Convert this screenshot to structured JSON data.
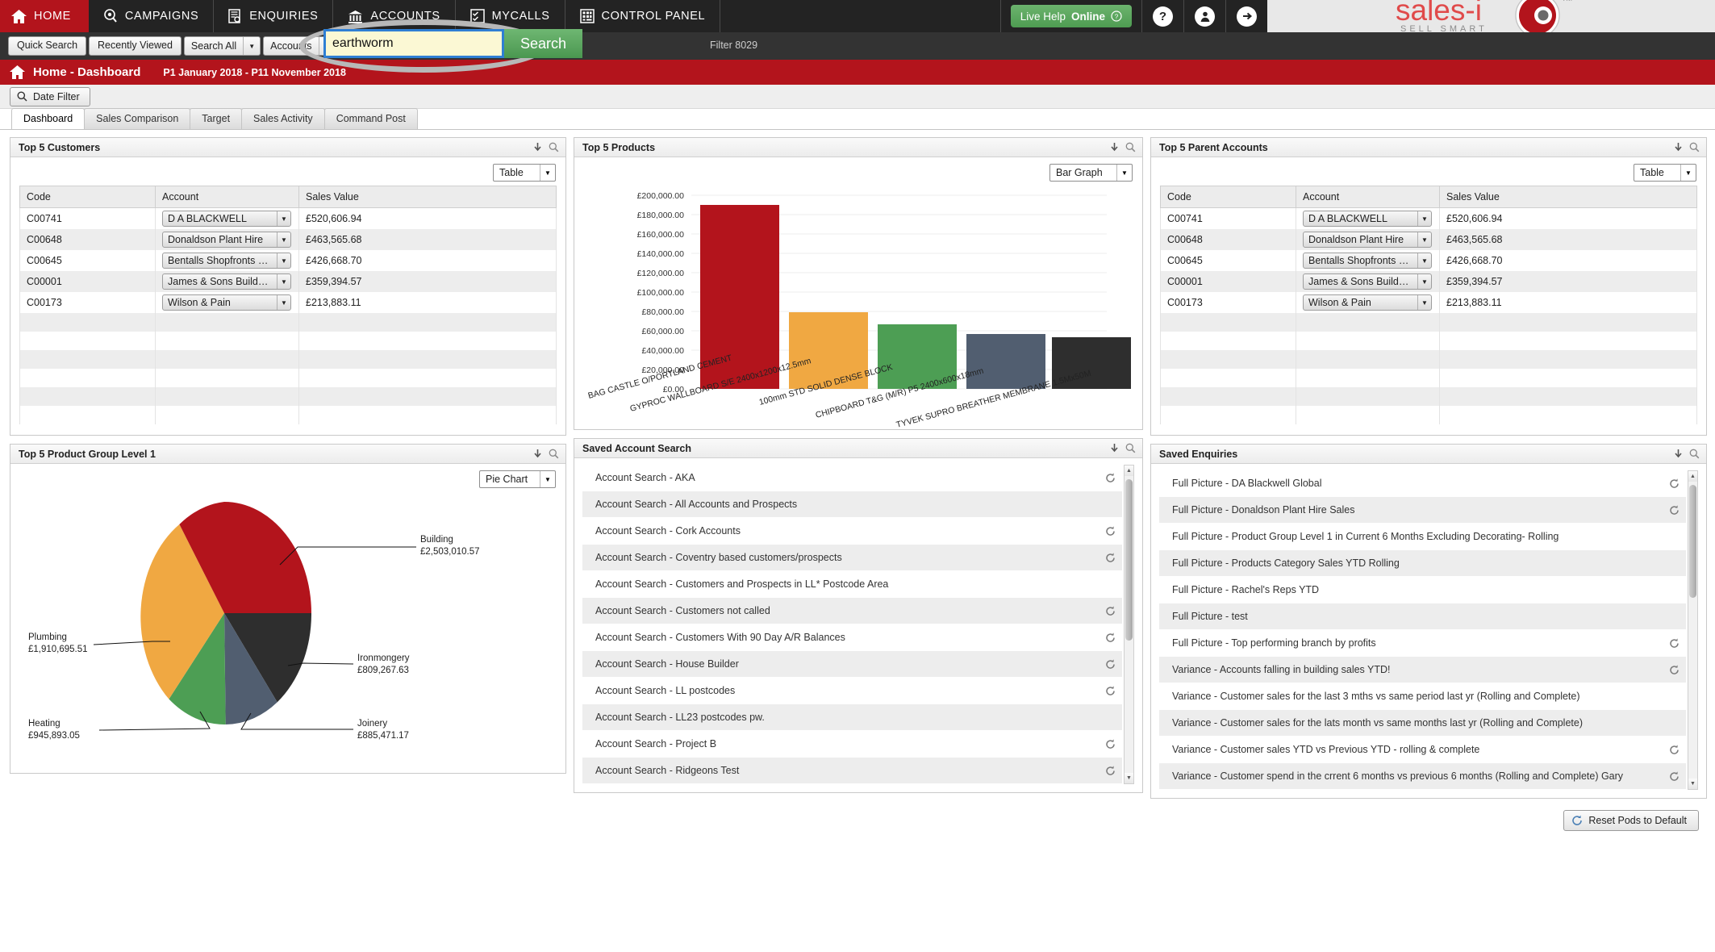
{
  "nav": {
    "items": [
      {
        "label": "HOME",
        "icon": "home-icon",
        "active": true
      },
      {
        "label": "CAMPAIGNS",
        "icon": "megaphone-icon",
        "active": false
      },
      {
        "label": "ENQUIRIES",
        "icon": "document-search-icon",
        "active": false
      },
      {
        "label": "ACCOUNTS",
        "icon": "bank-icon",
        "active": false
      },
      {
        "label": "MYCALLS",
        "icon": "checklist-icon",
        "active": false
      },
      {
        "label": "CONTROL PANEL",
        "icon": "grid-settings-icon",
        "active": false
      }
    ],
    "live_help": {
      "prefix": "Live Help ",
      "status": "Online",
      "icon": "question-circle-icon"
    },
    "icons": [
      {
        "name": "help-icon",
        "glyph": "?"
      },
      {
        "name": "user-profile-icon",
        "glyph": "❶"
      },
      {
        "name": "logout-icon",
        "glyph": "→"
      }
    ],
    "brand": {
      "name": "sales-i",
      "tagline": "SELL SMART",
      "trademark": "TM"
    }
  },
  "searchbar": {
    "quick_search": "Quick Search",
    "recently_viewed": "Recently Viewed",
    "search_scope": "Search All",
    "search_type": "Accounts",
    "query_value": "earthworm",
    "query_placeholder": "",
    "search_button": "Search",
    "filter_text": "Filter 8029"
  },
  "titlebar": {
    "icon": "home-icon",
    "title": "Home - Dashboard",
    "period": "P1 January 2018 - P11 November 2018"
  },
  "datefilter": {
    "label": "Date Filter",
    "icon": "magnifier-icon"
  },
  "tabs": [
    {
      "label": "Dashboard",
      "active": true
    },
    {
      "label": "Sales Comparison",
      "active": false
    },
    {
      "label": "Target",
      "active": false
    },
    {
      "label": "Sales Activity",
      "active": false
    },
    {
      "label": "Command Post",
      "active": false
    }
  ],
  "pods": {
    "top_customers": {
      "title": "Top 5 Customers",
      "view": "Table",
      "headers": [
        "Code",
        "Account",
        "Sales Value"
      ],
      "rows": [
        {
          "code": "C00741",
          "account": "D A BLACKWELL",
          "value": "£520,606.94"
        },
        {
          "code": "C00648",
          "account": "Donaldson Plant Hire",
          "value": "£463,565.68"
        },
        {
          "code": "C00645",
          "account": "Bentalls Shopfronts LTD",
          "value": "£426,668.70"
        },
        {
          "code": "C00001",
          "account": "James & Sons Builders...",
          "value": "£359,394.57"
        },
        {
          "code": "C00173",
          "account": "Wilson & Pain",
          "value": "£213,883.11"
        }
      ]
    },
    "top_parent_accounts": {
      "title": "Top 5 Parent Accounts",
      "view": "Table",
      "headers": [
        "Code",
        "Account",
        "Sales Value"
      ],
      "rows": [
        {
          "code": "C00741",
          "account": "D A BLACKWELL",
          "value": "£520,606.94"
        },
        {
          "code": "C00648",
          "account": "Donaldson Plant Hire",
          "value": "£463,565.68"
        },
        {
          "code": "C00645",
          "account": "Bentalls Shopfronts LTD",
          "value": "£426,668.70"
        },
        {
          "code": "C00001",
          "account": "James & Sons Builders...",
          "value": "£359,394.57"
        },
        {
          "code": "C00173",
          "account": "Wilson & Pain",
          "value": "£213,883.11"
        }
      ]
    },
    "top_products": {
      "title": "Top 5 Products",
      "view": "Bar Graph"
    },
    "product_group": {
      "title": "Top 5 Product Group Level 1",
      "view": "Pie Chart"
    },
    "saved_account_search": {
      "title": "Saved Account Search",
      "items": [
        {
          "label": "Account Search - AKA",
          "refresh": true
        },
        {
          "label": "Account Search - All Accounts and Prospects",
          "refresh": false
        },
        {
          "label": "Account Search - Cork Accounts",
          "refresh": true
        },
        {
          "label": "Account Search - Coventry based customers/prospects",
          "refresh": true
        },
        {
          "label": "Account Search - Customers and Prospects in LL* Postcode Area",
          "refresh": false
        },
        {
          "label": "Account Search - Customers not called",
          "refresh": true
        },
        {
          "label": "Account Search - Customers With 90 Day A/R Balances",
          "refresh": true
        },
        {
          "label": "Account Search - House Builder",
          "refresh": true
        },
        {
          "label": "Account Search - LL postcodes",
          "refresh": true
        },
        {
          "label": "Account Search - LL23 postcodes pw.",
          "refresh": false
        },
        {
          "label": "Account Search - Project B",
          "refresh": true
        },
        {
          "label": "Account Search - Ridgeons Test",
          "refresh": true
        }
      ]
    },
    "saved_enquiries": {
      "title": "Saved Enquiries",
      "items": [
        {
          "label": "Full Picture - DA Blackwell Global",
          "refresh": true
        },
        {
          "label": "Full Picture - Donaldson Plant Hire Sales",
          "refresh": true
        },
        {
          "label": "Full Picture - Product Group Level 1 in Current 6 Months  Excluding Decorating- Rolling",
          "refresh": false
        },
        {
          "label": "Full Picture - Products Category Sales YTD Rolling",
          "refresh": false
        },
        {
          "label": "Full Picture - Rachel's Reps YTD",
          "refresh": false
        },
        {
          "label": "Full Picture - test",
          "refresh": false
        },
        {
          "label": "Full Picture - Top performing branch by profits",
          "refresh": true
        },
        {
          "label": "Variance - Accounts falling in building sales YTD!",
          "refresh": true
        },
        {
          "label": "Variance - Customer sales for the last 3 mths vs same period last yr (Rolling and Complete)",
          "refresh": false
        },
        {
          "label": "Variance - Customer sales for the lats month vs same months last yr (Rolling and Complete)",
          "refresh": false
        },
        {
          "label": "Variance - Customer sales YTD vs Previous YTD - rolling & complete",
          "refresh": true
        },
        {
          "label": "Variance - Customer spend in the crrent 6 months vs previous 6 months (Rolling and Complete) Gary",
          "refresh": true
        }
      ]
    }
  },
  "footer": {
    "reset_label": "Reset Pods to Default",
    "reset_icon": "refresh-icon"
  },
  "chart_data": [
    {
      "type": "bar",
      "title": "Top 5 Products",
      "categories": [
        "BAG CASTLE O/PORTLAND CEMENT",
        "GYPROC WALLBOARD S/E 2400x1200x12.5mm",
        "100mm STD SOLID DENSE BLOCK",
        "CHIPBOARD T&G (M/R) P5 2400x600x18mm",
        "TYVEK SUPRO BREATHER MEMBRANE 1.5Mx50M"
      ],
      "values": [
        190000,
        79000,
        67000,
        57000,
        53000
      ],
      "colors": [
        "#b3141c",
        "#f0a842",
        "#4d9e54",
        "#515e70",
        "#2e2e2e"
      ],
      "xlabel": "",
      "ylabel": "",
      "ylim": [
        0,
        200000
      ],
      "yticks": [
        0,
        20000,
        40000,
        60000,
        80000,
        100000,
        120000,
        140000,
        160000,
        180000,
        200000
      ],
      "ytick_labels": [
        "£0.00",
        "£20,000.00",
        "£40,000.00",
        "£60,000.00",
        "£80,000.00",
        "£100,000.00",
        "£120,000.00",
        "£140,000.00",
        "£160,000.00",
        "£180,000.00",
        "£200,000.00"
      ],
      "grid": true,
      "legend": "none"
    },
    {
      "type": "pie",
      "title": "Top 5 Product Group Level 1",
      "labels": [
        "Building",
        "Plumbing",
        "Heating",
        "Joinery",
        "Ironmongery"
      ],
      "values": [
        2503010.57,
        1910695.51,
        945893.05,
        885471.17,
        809267.63
      ],
      "value_labels": [
        "£2,503,010.57",
        "£1,910,695.51",
        "£945,893.05",
        "£885,471.17",
        "£809,267.63"
      ],
      "colors": [
        "#b3141c",
        "#f0a842",
        "#4d9e54",
        "#515e70",
        "#2e2e2e"
      ],
      "legend": "callout-labels"
    }
  ],
  "colors": {
    "brand_red": "#b3141c",
    "nav_dark": "#232323",
    "accent_green": "#4e9c52",
    "series": [
      "#b3141c",
      "#f0a842",
      "#4d9e54",
      "#515e70",
      "#2e2e2e"
    ]
  }
}
